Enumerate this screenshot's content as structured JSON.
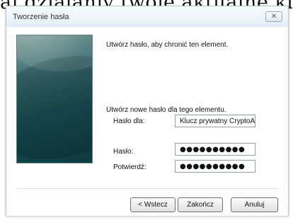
{
  "background": {
    "visible_text": "aj dzialaniy twoje aktualne klucz"
  },
  "dialog": {
    "title": "Tworzenie hasła",
    "close_symbol": "✕",
    "intro_text": "Utwórz hasło, aby chronić ten element.",
    "section_text": "Utwórz nowe hasło dla tego elementu.",
    "fields": {
      "for_label": "Hasło dla:",
      "for_value": "Klucz prywatny CryptoAPI",
      "password_label": "Hasło:",
      "password_value": "●●●●●●●●●●",
      "confirm_label": "Potwierdź:",
      "confirm_value": "●●●●●●●●●●"
    },
    "buttons": {
      "back": "< Wstecz",
      "finish": "Zakończ",
      "cancel": "Anuluj"
    }
  }
}
